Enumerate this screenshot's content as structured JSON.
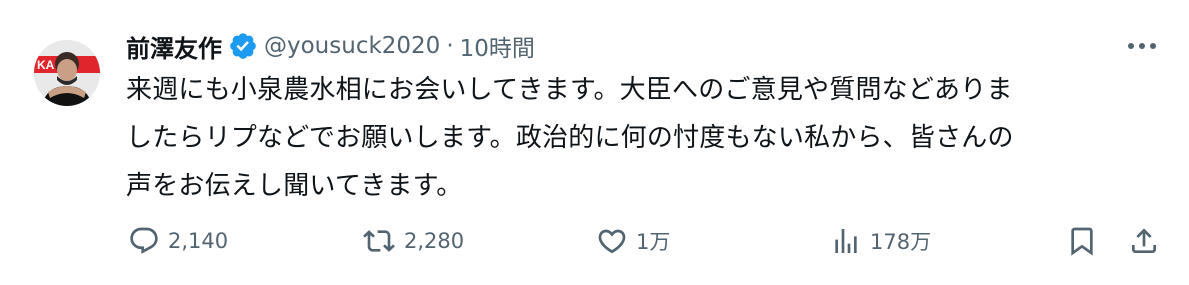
{
  "author": {
    "display_name": "前澤友作",
    "handle": "@yousuck2020",
    "separator": "·",
    "timestamp": "10時間",
    "verified": true,
    "avatar_text": "KA"
  },
  "tweet": {
    "text": "来週にも小泉農水相にお会いしてきます。大臣へのご意見や質問などありま\nしたらリプなどでお願いします。政治的に何の忖度もない私から、皆さんの\n声をお伝えし聞いてきます。"
  },
  "actions": {
    "replies": "2,140",
    "reposts": "2,280",
    "likes": "1万",
    "views": "178万"
  },
  "icons": {
    "verified": "verified-badge-icon",
    "more": "more-icon",
    "reply": "reply-icon",
    "repost": "repost-icon",
    "like": "like-icon",
    "views": "views-icon",
    "bookmark": "bookmark-icon",
    "share": "share-icon"
  },
  "colors": {
    "text": "#0f1419",
    "muted": "#536471",
    "verified": "#1d9bf0",
    "avatar_banner": "#e0262c"
  }
}
